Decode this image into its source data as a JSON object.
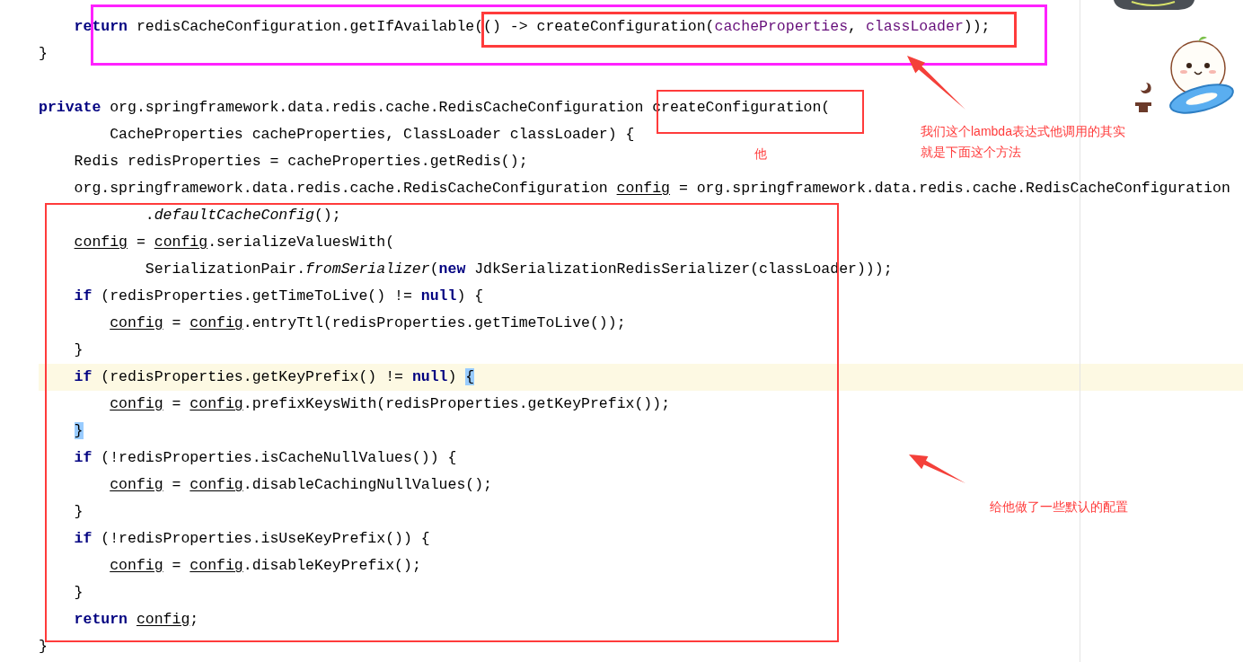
{
  "code_lines": [
    {
      "kind": "block",
      "children": [
        {
          "kind": "code",
          "highlighted": false,
          "segments": [
            {
              "kind": "keyword",
              "text": "return"
            },
            {
              "kind": "plain",
              "text": " redisCacheConfiguration.getIfAvailable(() -> createConfiguration("
            },
            {
              "kind": "param",
              "text": "cacheProperties"
            },
            {
              "kind": "plain",
              "text": ", "
            },
            {
              "kind": "param",
              "text": "classLoader"
            },
            {
              "kind": "plain",
              "text": "));"
            }
          ]
        }
      ]
    },
    {
      "kind": "code",
      "highlighted": false,
      "segments": [
        {
          "kind": "plain",
          "text": "}"
        }
      ]
    },
    {
      "kind": "blank"
    },
    {
      "kind": "code",
      "highlighted": false,
      "segments": [
        {
          "kind": "keyword",
          "text": "private"
        },
        {
          "kind": "plain",
          "text": " org.springframework.data.redis.cache.RedisCacheConfiguration createConfiguration("
        }
      ],
      "children": [
        {
          "kind": "continuation",
          "highlighted": false,
          "segments": [
            {
              "kind": "plain",
              "text": "CacheProperties cacheProperties, ClassLoader classLoader) {"
            }
          ]
        },
        {
          "kind": "code",
          "highlighted": false,
          "segments": [
            {
              "kind": "plain",
              "text": "Redis redisProperties = cacheProperties.getRedis();"
            }
          ]
        },
        {
          "kind": "code",
          "highlighted": false,
          "segments": [
            {
              "kind": "plain",
              "text": "org.springframework.data.redis.cache.RedisCacheConfiguration "
            },
            {
              "kind": "var",
              "text": "config"
            },
            {
              "kind": "plain",
              "text": " = org.springframework.data.redis.cache.RedisCacheConfiguration"
            }
          ],
          "children": [
            {
              "kind": "continuation",
              "highlighted": false,
              "segments": [
                {
                  "kind": "plain",
                  "text": "."
                },
                {
                  "kind": "italic",
                  "text": "defaultCacheConfig"
                },
                {
                  "kind": "plain",
                  "text": "();"
                }
              ]
            }
          ]
        },
        {
          "kind": "code",
          "highlighted": false,
          "segments": [
            {
              "kind": "var",
              "text": "config"
            },
            {
              "kind": "plain",
              "text": " = "
            },
            {
              "kind": "var",
              "text": "config"
            },
            {
              "kind": "plain",
              "text": ".serializeValuesWith("
            }
          ],
          "children": [
            {
              "kind": "continuation",
              "highlighted": false,
              "segments": [
                {
                  "kind": "plain",
                  "text": "SerializationPair."
                },
                {
                  "kind": "italic",
                  "text": "fromSerializer"
                },
                {
                  "kind": "plain",
                  "text": "("
                },
                {
                  "kind": "keyword",
                  "text": "new"
                },
                {
                  "kind": "plain",
                  "text": " JdkSerializationRedisSerializer(classLoader)));"
                }
              ]
            }
          ]
        },
        {
          "kind": "code",
          "highlighted": false,
          "segments": [
            {
              "kind": "keyword",
              "text": "if"
            },
            {
              "kind": "plain",
              "text": " (redisProperties.getTimeToLive() != "
            },
            {
              "kind": "keyword",
              "text": "null"
            },
            {
              "kind": "plain",
              "text": ") {"
            }
          ],
          "children": [
            {
              "kind": "code",
              "highlighted": false,
              "segments": [
                {
                  "kind": "var",
                  "text": "config"
                },
                {
                  "kind": "plain",
                  "text": " = "
                },
                {
                  "kind": "var",
                  "text": "config"
                },
                {
                  "kind": "plain",
                  "text": ".entryTtl(redisProperties.getTimeToLive());"
                }
              ]
            }
          ]
        },
        {
          "kind": "code",
          "highlighted": false,
          "segments": [
            {
              "kind": "plain",
              "text": "}"
            }
          ]
        },
        {
          "kind": "code",
          "highlighted": true,
          "segments": [
            {
              "kind": "keyword",
              "text": "if"
            },
            {
              "kind": "plain",
              "text": " (redisProperties.getKeyPrefix() != "
            },
            {
              "kind": "keyword",
              "text": "null"
            },
            {
              "kind": "plain",
              "text": ") "
            },
            {
              "kind": "match",
              "text": "{"
            }
          ],
          "children": [
            {
              "kind": "code",
              "highlighted": false,
              "segments": [
                {
                  "kind": "var",
                  "text": "config"
                },
                {
                  "kind": "plain",
                  "text": " = "
                },
                {
                  "kind": "var",
                  "text": "config"
                },
                {
                  "kind": "plain",
                  "text": ".prefixKeysWith(redisProperties.getKeyPrefix());"
                }
              ]
            }
          ]
        },
        {
          "kind": "code",
          "highlighted": false,
          "segments": [
            {
              "kind": "match",
              "text": "}"
            }
          ]
        },
        {
          "kind": "code",
          "highlighted": false,
          "segments": [
            {
              "kind": "keyword",
              "text": "if"
            },
            {
              "kind": "plain",
              "text": " (!redisProperties.isCacheNullValues()) {"
            }
          ],
          "children": [
            {
              "kind": "code",
              "highlighted": false,
              "segments": [
                {
                  "kind": "var",
                  "text": "config"
                },
                {
                  "kind": "plain",
                  "text": " = "
                },
                {
                  "kind": "var",
                  "text": "config"
                },
                {
                  "kind": "plain",
                  "text": ".disableCachingNullValues();"
                }
              ]
            }
          ]
        },
        {
          "kind": "code",
          "highlighted": false,
          "segments": [
            {
              "kind": "plain",
              "text": "}"
            }
          ]
        },
        {
          "kind": "code",
          "highlighted": false,
          "segments": [
            {
              "kind": "keyword",
              "text": "if"
            },
            {
              "kind": "plain",
              "text": " (!redisProperties.isUseKeyPrefix()) {"
            }
          ],
          "children": [
            {
              "kind": "code",
              "highlighted": false,
              "segments": [
                {
                  "kind": "var",
                  "text": "config"
                },
                {
                  "kind": "plain",
                  "text": " = "
                },
                {
                  "kind": "var",
                  "text": "config"
                },
                {
                  "kind": "plain",
                  "text": ".disableKeyPrefix();"
                }
              ]
            }
          ]
        },
        {
          "kind": "code",
          "highlighted": false,
          "segments": [
            {
              "kind": "plain",
              "text": "}"
            }
          ]
        },
        {
          "kind": "code",
          "highlighted": false,
          "segments": [
            {
              "kind": "keyword",
              "text": "return "
            },
            {
              "kind": "var",
              "text": "config"
            },
            {
              "kind": "plain",
              "text": ";"
            }
          ]
        }
      ]
    },
    {
      "kind": "code",
      "highlighted": false,
      "segments": [
        {
          "kind": "plain",
          "text": "}"
        }
      ]
    }
  ],
  "annotation_boxes": [
    {
      "color": "#ff22ff"
    },
    {
      "color": "#ff3b3b"
    },
    {
      "color": "#ff3b3b"
    },
    {
      "color": "#ff3b3b"
    }
  ],
  "notes": [
    {
      "lines": [
        "他"
      ]
    },
    {
      "lines": [
        "我们这个lambda表达式他调用的其实",
        "就是下面这个方法"
      ]
    },
    {
      "lines": [
        "给他做了一些默认的配置"
      ]
    }
  ]
}
